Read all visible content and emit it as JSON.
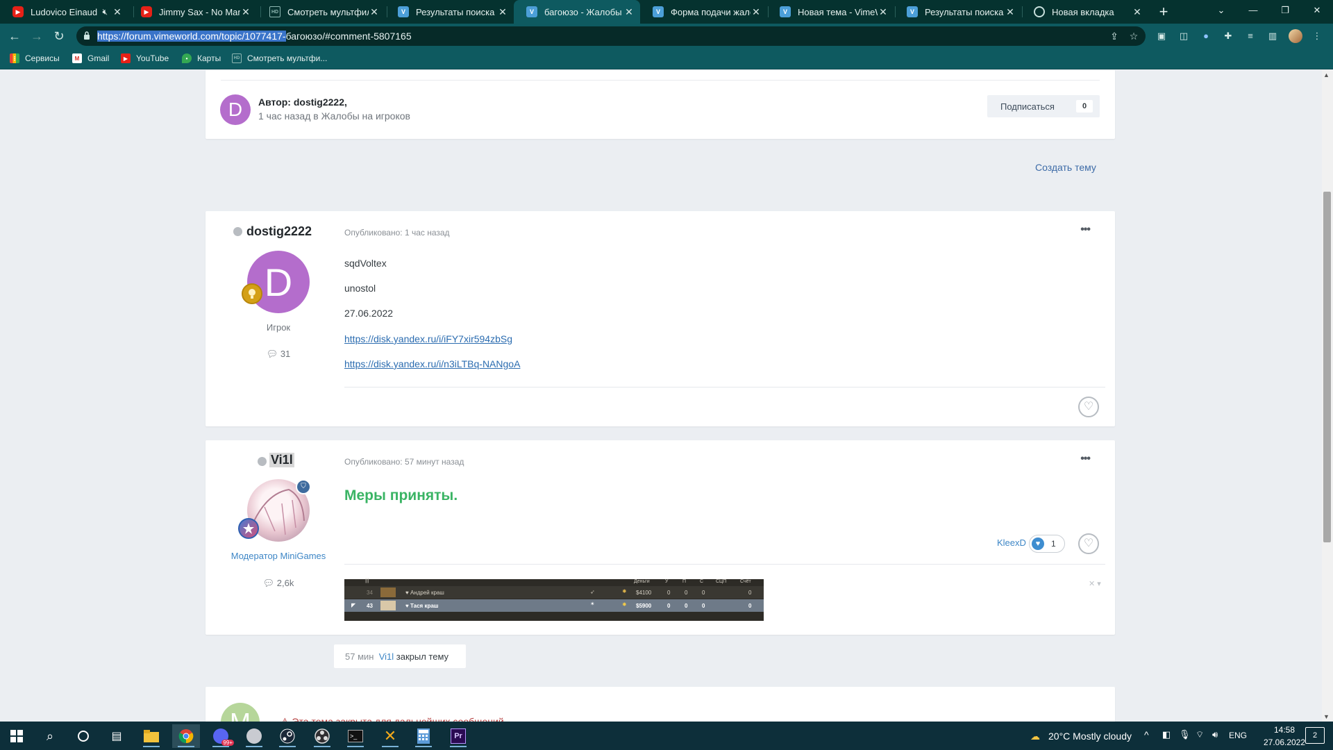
{
  "browser": {
    "tabs": [
      {
        "title": "Ludovico Einaudi",
        "icon": "youtube-icon",
        "muted": true
      },
      {
        "title": "Jimmy Sax - No Man N",
        "icon": "youtube-icon"
      },
      {
        "title": "Смотреть мультфильм",
        "icon": "hd-icon"
      },
      {
        "title": "Результаты поиска по",
        "icon": "vimeworld-icon"
      },
      {
        "title": "багоюзо - Жалобы на",
        "icon": "vimeworld-icon",
        "active": true
      },
      {
        "title": "Форма подачи жалоб",
        "icon": "vimeworld-icon"
      },
      {
        "title": "Новая тема - VimeWo",
        "icon": "vimeworld-icon"
      },
      {
        "title": "Результаты поиска по",
        "icon": "vimeworld-icon"
      },
      {
        "title": "Новая вкладка",
        "icon": "chrome-icon"
      }
    ],
    "url_selected": "https://forum.vimeworld.com/topic/1077417-",
    "url_rest": "багоюзо/#comment-5807165",
    "bookmarks": [
      {
        "label": "Сервисы",
        "icon": "apps-grid-icon"
      },
      {
        "label": "Gmail",
        "icon": "gmail-icon"
      },
      {
        "label": "YouTube",
        "icon": "youtube-icon"
      },
      {
        "label": "Карты",
        "icon": "maps-icon"
      },
      {
        "label": "Смотреть мультфи...",
        "icon": "hd-icon"
      }
    ],
    "colors": {
      "tabbar": "#05322f",
      "toolbar": "#0e5a60"
    }
  },
  "topic": {
    "author_prefix": "Автор: dostig2222,",
    "author_initial": "D",
    "meta": "1 час назад в Жалобы на игроков",
    "subscribe_label": "Подписаться",
    "subscribe_count": "0",
    "create_topic": "Создать тему"
  },
  "posts": [
    {
      "username": "dostig2222",
      "initial": "D",
      "role": "Игрок",
      "post_count": "31",
      "published": "Опубликовано: 1 час назад",
      "lines": [
        "sqdVoltex",
        "unostol",
        "27.06.2022"
      ],
      "links": [
        "https://disk.yandex.ru/i/iFY7xir594zbSg",
        "https://disk.yandex.ru/i/n3iLTBq-NANgoA"
      ]
    },
    {
      "username": "Vi1l",
      "role": "Модератор MiniGames",
      "post_count": "2,6k",
      "published": "Опубликовано: 57 минут назад",
      "text": "Меры приняты.",
      "reaction_user": "KleexD",
      "reaction_count": "1",
      "scoreboard": {
        "headers": [
          "Деньги",
          "У",
          "П",
          "С",
          "СЦП",
          "Счёт"
        ],
        "rows": [
          {
            "ping": "34",
            "name": "♥ Андрей краш",
            "money": "$4100",
            "k": "0",
            "a": "0",
            "d": "0",
            "score": "0"
          },
          {
            "ping": "43",
            "name": "♥ Тася краш",
            "money": "$5900",
            "k": "0",
            "a": "0",
            "d": "0",
            "score": "0"
          }
        ]
      }
    }
  ],
  "closed_event": {
    "time": "57 мин",
    "user": "Vi1l",
    "action": "закрыл тему"
  },
  "locked_notice": "Эта тема закрыта для дальнейших сообщений.",
  "bottom_initial": "M",
  "taskbar": {
    "weather": "20°C  Mostly cloudy",
    "lang": "ENG",
    "time": "14:58",
    "date": "27.06.2022",
    "notifications": "2",
    "discord_badge": "99+",
    "premiere_label": "Pr"
  }
}
